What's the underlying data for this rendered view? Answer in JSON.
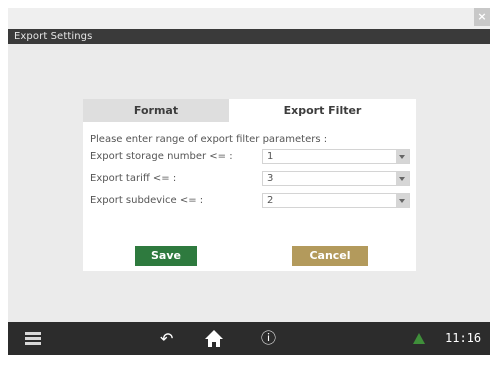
{
  "window": {
    "title": "Export Settings",
    "close_glyph": "×"
  },
  "tabs": [
    {
      "label": "Format",
      "selected": false
    },
    {
      "label": "Export Filter",
      "selected": true
    }
  ],
  "filter": {
    "prompt": "Please enter range of export filter parameters :",
    "rows": [
      {
        "label": "Export storage number <= :",
        "value": "1"
      },
      {
        "label": "Export tariff <= :",
        "value": "3"
      },
      {
        "label": "Export subdevice <= :",
        "value": "2"
      }
    ]
  },
  "buttons": {
    "save": "Save",
    "cancel": "Cancel"
  },
  "taskbar": {
    "icons": [
      "menu-icon",
      "back-icon",
      "home-icon",
      "info-icon",
      "alert-icon"
    ],
    "back_glyph": "↶",
    "info_glyph": "ⓘ",
    "clock": "11:16"
  },
  "colors": {
    "save_button": "#2e7a3e",
    "cancel_button": "#b39a5c",
    "taskbar": "#2c2c2c",
    "alert": "#3f8f3a"
  }
}
